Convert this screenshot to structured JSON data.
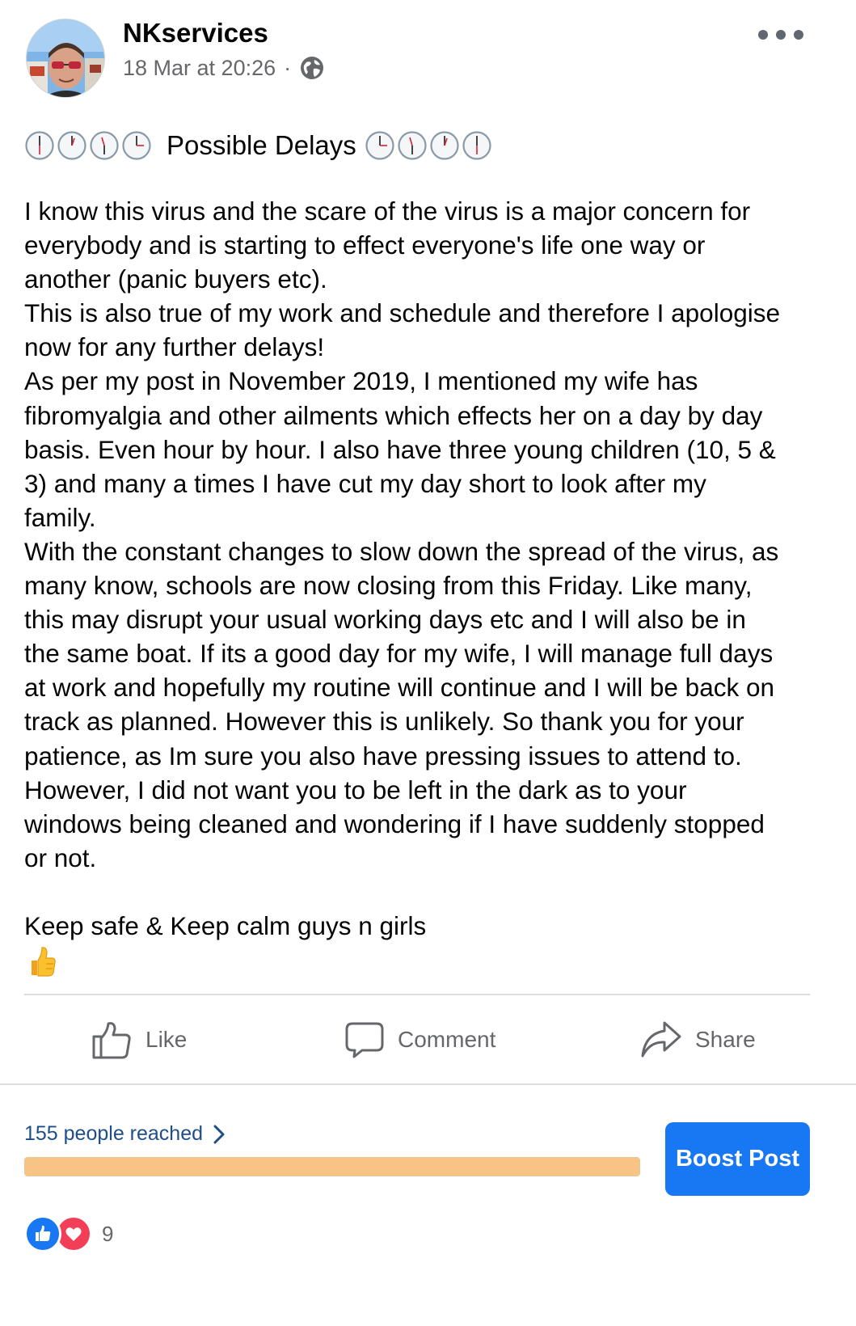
{
  "post": {
    "author": "NKservices",
    "timestamp": "18 Mar at 20:26",
    "separator": "·",
    "privacy_icon": "globe-icon",
    "title": "Possible Delays",
    "title_decoration_icon": "clock-icon",
    "body_lines": [
      "I know this virus and the scare of the virus is a major concern for",
      "everybody and is starting to effect everyone's life one way or",
      "another (panic buyers etc).",
      "This is also true of my work and schedule and therefore I apologise",
      "now for any further delays!",
      "As per my post in November 2019, I mentioned my wife has",
      "fibromyalgia and other ailments which effects her on a day by day",
      "basis. Even hour by hour.  I also have three young children (10, 5 &",
      "3) and many a times I have cut my day short to look after my",
      "family.",
      "With the constant changes to slow down the spread of the virus, as",
      "many know, schools are now closing from this Friday.   Like many,",
      "this may disrupt your usual working days etc and I will also be in",
      "the same boat.  If its a good day for my wife, I will manage full days",
      "at work and hopefully my routine will continue and I will be back on",
      "track as planned.  However this is unlikely.  So thank you for your",
      "patience, as Im sure you also have pressing issues to attend to.",
      "However, I did not want you to be left in the dark as to your",
      "windows being cleaned and wondering if I have suddenly stopped",
      "or not.",
      "",
      "Keep safe & Keep calm guys n girls"
    ],
    "closing_emoji": "thumbs-up-emoji"
  },
  "actions": {
    "like": "Like",
    "comment": "Comment",
    "share": "Share"
  },
  "insights": {
    "reach_label": "155 people reached",
    "reach_progress": 1.0,
    "boost_label": "Boost Post"
  },
  "reactions": {
    "types": [
      "like",
      "love"
    ],
    "count": "9"
  },
  "colors": {
    "accent": "#1877f2",
    "secondary_text": "#65676b",
    "progress_fill": "#f7c483",
    "love": "#f33e58",
    "reach_link": "#1d4e89"
  }
}
